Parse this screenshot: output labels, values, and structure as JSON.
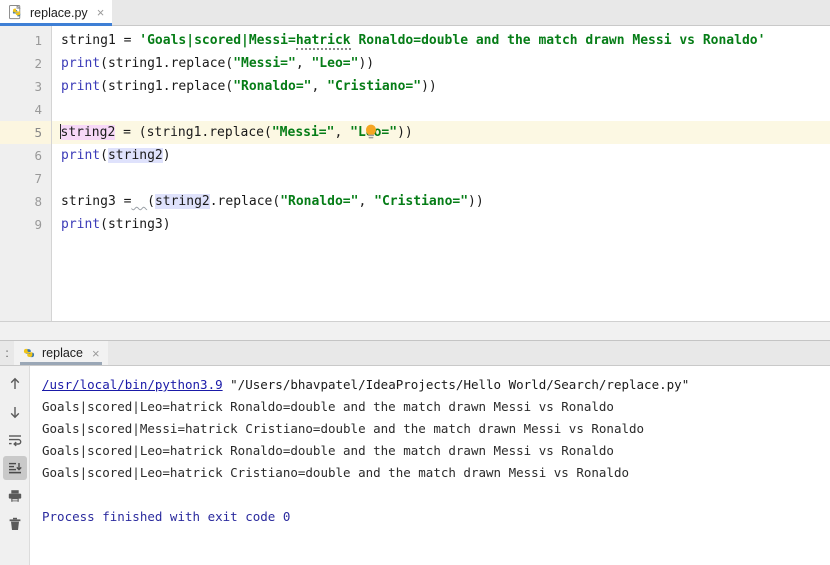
{
  "window": {
    "app": "PyCharm-like IDE"
  },
  "editor_tabs": [
    {
      "label": "replace.py",
      "icon": "python-file-icon",
      "close": "×",
      "active": true
    }
  ],
  "editor": {
    "line_numbers": [
      "1",
      "2",
      "3",
      "4",
      "5",
      "6",
      "7",
      "8",
      "9"
    ],
    "current_line": 5,
    "intention_icon": "lightbulb-icon",
    "lines": [
      {
        "n": 1,
        "tokens": [
          {
            "t": "string1 = ",
            "c": "t-def"
          },
          {
            "t": "'Goals|scored|Messi=",
            "c": "t-str"
          },
          {
            "t": "hatrick",
            "c": "t-str typo"
          },
          {
            "t": " Ronaldo=double and the match drawn Messi vs Ronaldo'",
            "c": "t-str"
          }
        ]
      },
      {
        "n": 2,
        "tokens": [
          {
            "t": "print",
            "c": "t-fn"
          },
          {
            "t": "(string1.replace(",
            "c": "t-def"
          },
          {
            "t": "\"Messi=\"",
            "c": "t-str"
          },
          {
            "t": ", ",
            "c": "t-def"
          },
          {
            "t": "\"Leo=\"",
            "c": "t-str"
          },
          {
            "t": "))",
            "c": "t-def"
          }
        ]
      },
      {
        "n": 3,
        "tokens": [
          {
            "t": "print",
            "c": "t-fn"
          },
          {
            "t": "(string1.replace(",
            "c": "t-def"
          },
          {
            "t": "\"Ronaldo=\"",
            "c": "t-str"
          },
          {
            "t": ", ",
            "c": "t-def"
          },
          {
            "t": "\"Cristiano=\"",
            "c": "t-str"
          },
          {
            "t": "))",
            "c": "t-def"
          }
        ]
      },
      {
        "n": 4,
        "tokens": []
      },
      {
        "n": 5,
        "current": true,
        "tokens": [
          {
            "t": "string2",
            "c": "t-def hl-write",
            "caret_before": true
          },
          {
            "t": " = (string1.replace(",
            "c": "t-def"
          },
          {
            "t": "\"Messi=\"",
            "c": "t-str"
          },
          {
            "t": ", ",
            "c": "t-def"
          },
          {
            "t": "\"Leo=\"",
            "c": "t-str"
          },
          {
            "t": "))",
            "c": "t-def"
          }
        ]
      },
      {
        "n": 6,
        "tokens": [
          {
            "t": "print",
            "c": "t-fn"
          },
          {
            "t": "(",
            "c": "t-def"
          },
          {
            "t": "string2",
            "c": "t-def hl-read"
          },
          {
            "t": ")",
            "c": "t-def"
          }
        ]
      },
      {
        "n": 7,
        "tokens": []
      },
      {
        "n": 8,
        "tokens": [
          {
            "t": "string3 =",
            "c": "t-def"
          },
          {
            "t": "  ",
            "c": "t-def squig"
          },
          {
            "t": "(",
            "c": "t-def"
          },
          {
            "t": "string2",
            "c": "t-def hl-read"
          },
          {
            "t": ".replace(",
            "c": "t-def"
          },
          {
            "t": "\"Ronaldo=\"",
            "c": "t-str"
          },
          {
            "t": ", ",
            "c": "t-def"
          },
          {
            "t": "\"Cristiano=\"",
            "c": "t-str"
          },
          {
            "t": "))",
            "c": "t-def"
          }
        ]
      },
      {
        "n": 9,
        "tokens": [
          {
            "t": "print",
            "c": "t-fn"
          },
          {
            "t": "(string3)",
            "c": "t-def"
          }
        ]
      }
    ]
  },
  "run_panel": {
    "prefix": ":",
    "tab": {
      "label": "replace",
      "icon": "python-icon",
      "close": "×"
    },
    "toolbar": [
      {
        "name": "up-arrow-icon",
        "glyph": "↑",
        "active": false
      },
      {
        "name": "down-arrow-icon",
        "glyph": "↓",
        "active": false
      },
      {
        "name": "soft-wrap-icon",
        "glyph": "wrap",
        "active": false
      },
      {
        "name": "scroll-to-end-icon",
        "glyph": "end",
        "active": true
      },
      {
        "name": "print-icon",
        "glyph": "print",
        "active": false
      },
      {
        "name": "trash-icon",
        "glyph": "trash",
        "active": false
      }
    ],
    "command": {
      "interpreter": "/usr/local/bin/python3.9",
      "script": "\"/Users/bhavpatel/IdeaProjects/Hello World/Search/replace.py\""
    },
    "output": [
      "Goals|scored|Leo=hatrick Ronaldo=double and the match drawn Messi vs Ronaldo",
      "Goals|scored|Messi=hatrick Cristiano=double and the match drawn Messi vs Ronaldo",
      "Goals|scored|Leo=hatrick Ronaldo=double and the match drawn Messi vs Ronaldo",
      "Goals|scored|Leo=hatrick Cristiano=double and the match drawn Messi vs Ronaldo"
    ],
    "exit_message": "Process finished with exit code 0"
  },
  "colors": {
    "string": "#067d17",
    "keyword_fn": "#3b3bb8",
    "link": "#1a1aa8",
    "tab_underline": "#3e7fd5",
    "current_line": "#fcf8e3",
    "write_usage": "#f7d8f7",
    "read_usage": "#dfe2fc",
    "bulb": "#f5a623"
  }
}
